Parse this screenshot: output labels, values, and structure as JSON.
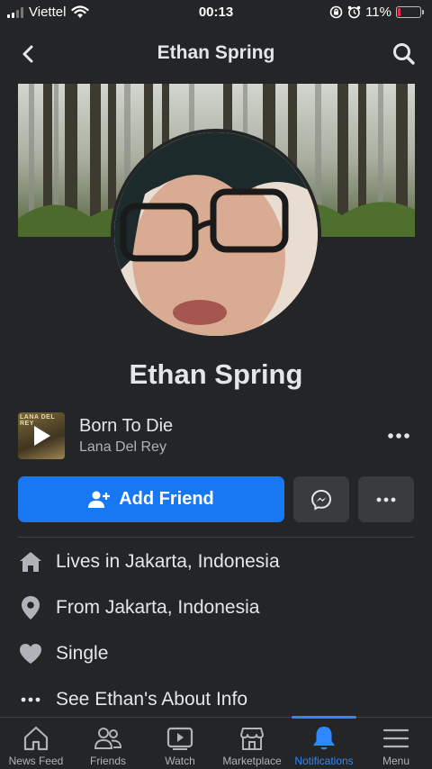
{
  "status_bar": {
    "carrier": "Viettel",
    "time": "00:13",
    "battery_percent": "11%",
    "battery_level": 0.11
  },
  "header": {
    "title": "Ethan Spring"
  },
  "profile": {
    "name": "Ethan Spring"
  },
  "music": {
    "song_title": "Born To Die",
    "artist": "Lana Del Rey",
    "album_text": "LANA DEL REY"
  },
  "actions": {
    "add_friend_label": "Add Friend"
  },
  "info": {
    "lives_prefix": "Lives in ",
    "lives_place": "Jakarta, Indonesia",
    "from_prefix": "From ",
    "from_place": "Jakarta, Indonesia",
    "relationship": "Single",
    "about_link": "See Ethan's About Info"
  },
  "tab_bar": {
    "tabs": [
      {
        "label": "News Feed",
        "icon": "home-icon"
      },
      {
        "label": "Friends",
        "icon": "friends-icon"
      },
      {
        "label": "Watch",
        "icon": "watch-icon"
      },
      {
        "label": "Marketplace",
        "icon": "marketplace-icon"
      },
      {
        "label": "Notifications",
        "icon": "bell-icon"
      },
      {
        "label": "Menu",
        "icon": "menu-icon"
      }
    ],
    "active_tab": "Notifications"
  },
  "colors": {
    "background": "#242526",
    "accent": "#1877f2",
    "active_tab": "#2d88ff",
    "button_secondary": "#3a3b3c"
  }
}
